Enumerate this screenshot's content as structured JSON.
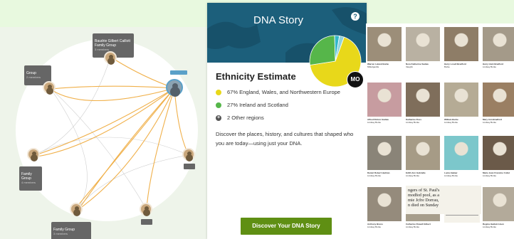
{
  "network": {
    "center_badge": "",
    "groups": [
      {
        "title": "Baudrie Gilbert Caillott\nFamily Group",
        "sub": "3 members"
      },
      {
        "title": "Group",
        "sub": "2 members"
      },
      {
        "title": "Family\nGroup",
        "sub": "4 members"
      },
      {
        "title": "Family Group",
        "sub": "3 members"
      }
    ]
  },
  "dna": {
    "title": "DNA Story",
    "help": "?",
    "avatar": "MO",
    "ethnicity_title": "Ethnicity Estimate",
    "regions": [
      {
        "label": "67% England, Wales, and Northwestern Europe",
        "color": "#e8d81a"
      },
      {
        "label": "27% Ireland and Scotland",
        "color": "#56b64a"
      },
      {
        "label": "2 Other regions",
        "color": "#555555"
      }
    ],
    "description": "Discover the places, history, and cultures that shaped who you are today—using just your DNA.",
    "cta": "Discover Your DNA Story"
  },
  "photos": [
    {
      "name": "Warren Leland Burke",
      "detail": "Milledgeville"
    },
    {
      "name": "Nora Katherine Sadaw",
      "detail": "Vaughn"
    },
    {
      "name": "Harry Lovell Bradford",
      "detail": "Burke"
    },
    {
      "name": "Harry Hunt Bradford",
      "detail": "Lindsay Burke"
    },
    {
      "name": "Alfred Rohrer Hadaw",
      "detail": "Lindsay Burke"
    },
    {
      "name": "Katharine Ross",
      "detail": "Lindsay Burke"
    },
    {
      "name": "William Burke",
      "detail": "Lindsay Burke"
    },
    {
      "name": "Mary Ann Bradford",
      "detail": "Lindsay Burke"
    },
    {
      "name": "Daniel Robert Hadrian",
      "detail": "Lindsay Burke"
    },
    {
      "name": "Edith Ann Gabrielle",
      "detail": "Lindsay Burke"
    },
    {
      "name": "Lucia Hadaw",
      "detail": "Lindsay Burke"
    },
    {
      "name": "Marie Jean Francine Collet",
      "detail": "Lindsay Burke"
    },
    {
      "name": "Anthony Bruno",
      "detail": "Lindsay Burke"
    },
    {
      "name": "Catherine Rowell Gilbert",
      "detail": "Lindsay Burke"
    },
    {
      "name": "",
      "detail": ""
    },
    {
      "name": "Regina Hadwin Hoen",
      "detail": "Lindsay Burke"
    }
  ],
  "news": {
    "headline": "ngers of St. Paul's\nmodfed pool, as a\nmie Jcfre Dorrau,\nn died on Sunday"
  },
  "colors": {
    "link": "#f0b04a",
    "header": "#1c5f7b",
    "cta": "#5f8f13"
  }
}
